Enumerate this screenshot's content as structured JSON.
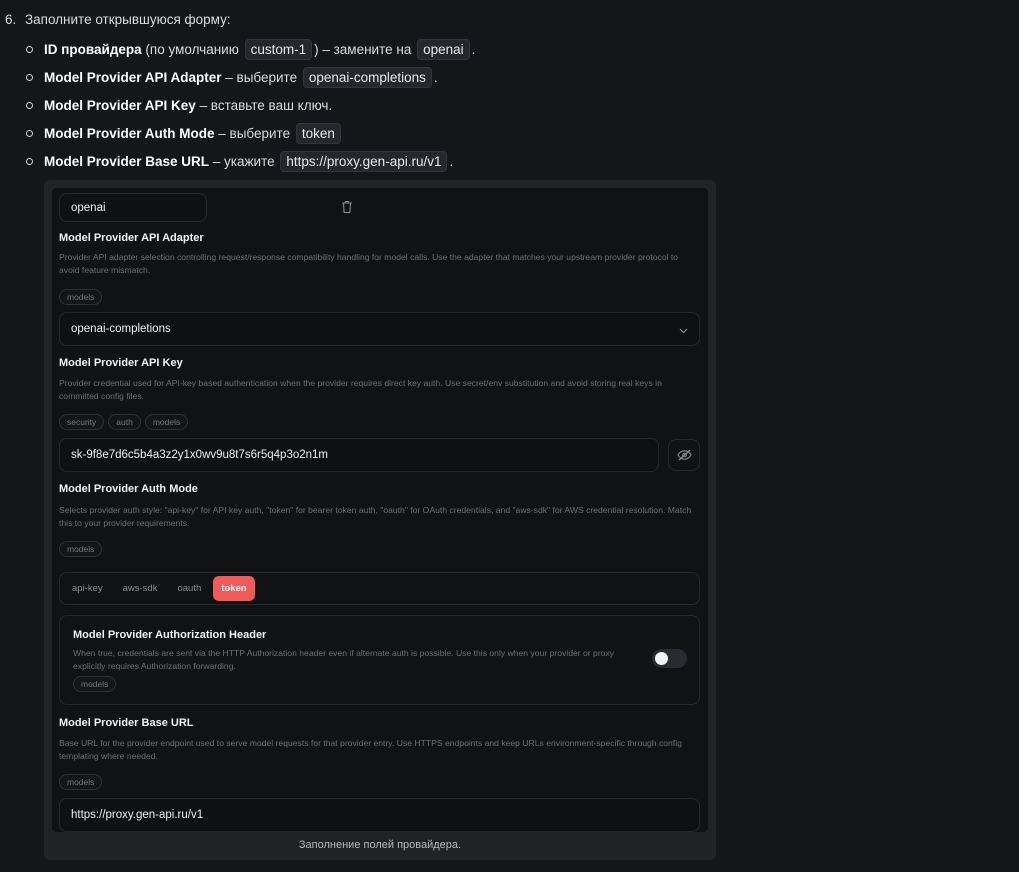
{
  "instructions": {
    "step_number": "6.",
    "step_text": "Заполните открывшуюся форму:",
    "items": [
      {
        "bold": "ID провайдера",
        "pre": " (по умолчанию ",
        "chip": "custom-1",
        "mid": ") – замените на ",
        "chip2": "openai",
        "post": "."
      },
      {
        "bold": "Model Provider API Adapter",
        "pre": " – выберите ",
        "chip": "openai-completions",
        "post": "."
      },
      {
        "bold": "Model Provider API Key",
        "pre": " – вставьте ваш ключ."
      },
      {
        "bold": "Model Provider Auth Mode",
        "pre": " – выберите ",
        "chip": "token"
      },
      {
        "bold": "Model Provider Base URL",
        "pre": " – укажите ",
        "chip": "https://proxy.gen-api.ru/v1",
        "post": "."
      }
    ]
  },
  "form": {
    "provider_id_value": "openai",
    "api_adapter": {
      "label": "Model Provider API Adapter",
      "description": "Provider API adapter selection controlling request/response compatibility handling for model calls. Use the adapter that matches your upstream provider protocol to avoid feature mismatch.",
      "tags": [
        "models"
      ],
      "selected": "openai-completions"
    },
    "api_key": {
      "label": "Model Provider API Key",
      "description": "Provider credential used for API-key based authentication when the provider requires direct key auth. Use secret/env substitution and avoid storing real keys in committed config files.",
      "tags": [
        "security",
        "auth",
        "models"
      ],
      "value": "sk-9f8e7d6c5b4a3z2y1x0wv9u8t7s6r5q4p3o2n1m"
    },
    "auth_mode": {
      "label": "Model Provider Auth Mode",
      "description": "Selects provider auth style: \"api-key\" for API key auth, \"token\" for bearer token auth, \"oauth\" for OAuth credentials, and \"aws-sdk\" for AWS credential resolution. Match this to your provider requirements.",
      "tags": [
        "models"
      ],
      "options": [
        "api-key",
        "aws-sdk",
        "oauth",
        "token"
      ],
      "selected": "token"
    },
    "auth_header": {
      "label": "Model Provider Authorization Header",
      "description": "When true, credentials are sent via the HTTP Authorization header even if alternate auth is possible. Use this only when your provider or proxy explicitly requires Authorization forwarding.",
      "tags": [
        "models"
      ],
      "enabled": false
    },
    "base_url": {
      "label": "Model Provider Base URL",
      "description": "Base URL for the provider endpoint used to serve model requests for that provider entry. Use HTTPS endpoints and keep URLs environment-specific through config templating where needed.",
      "tags": [
        "models"
      ],
      "value": "https://proxy.gen-api.ru/v1"
    }
  },
  "caption": "Заполнение полей провайдера.",
  "colors": {
    "accent": "#f25a5a",
    "background": "#15161a",
    "panel": "#111214"
  }
}
